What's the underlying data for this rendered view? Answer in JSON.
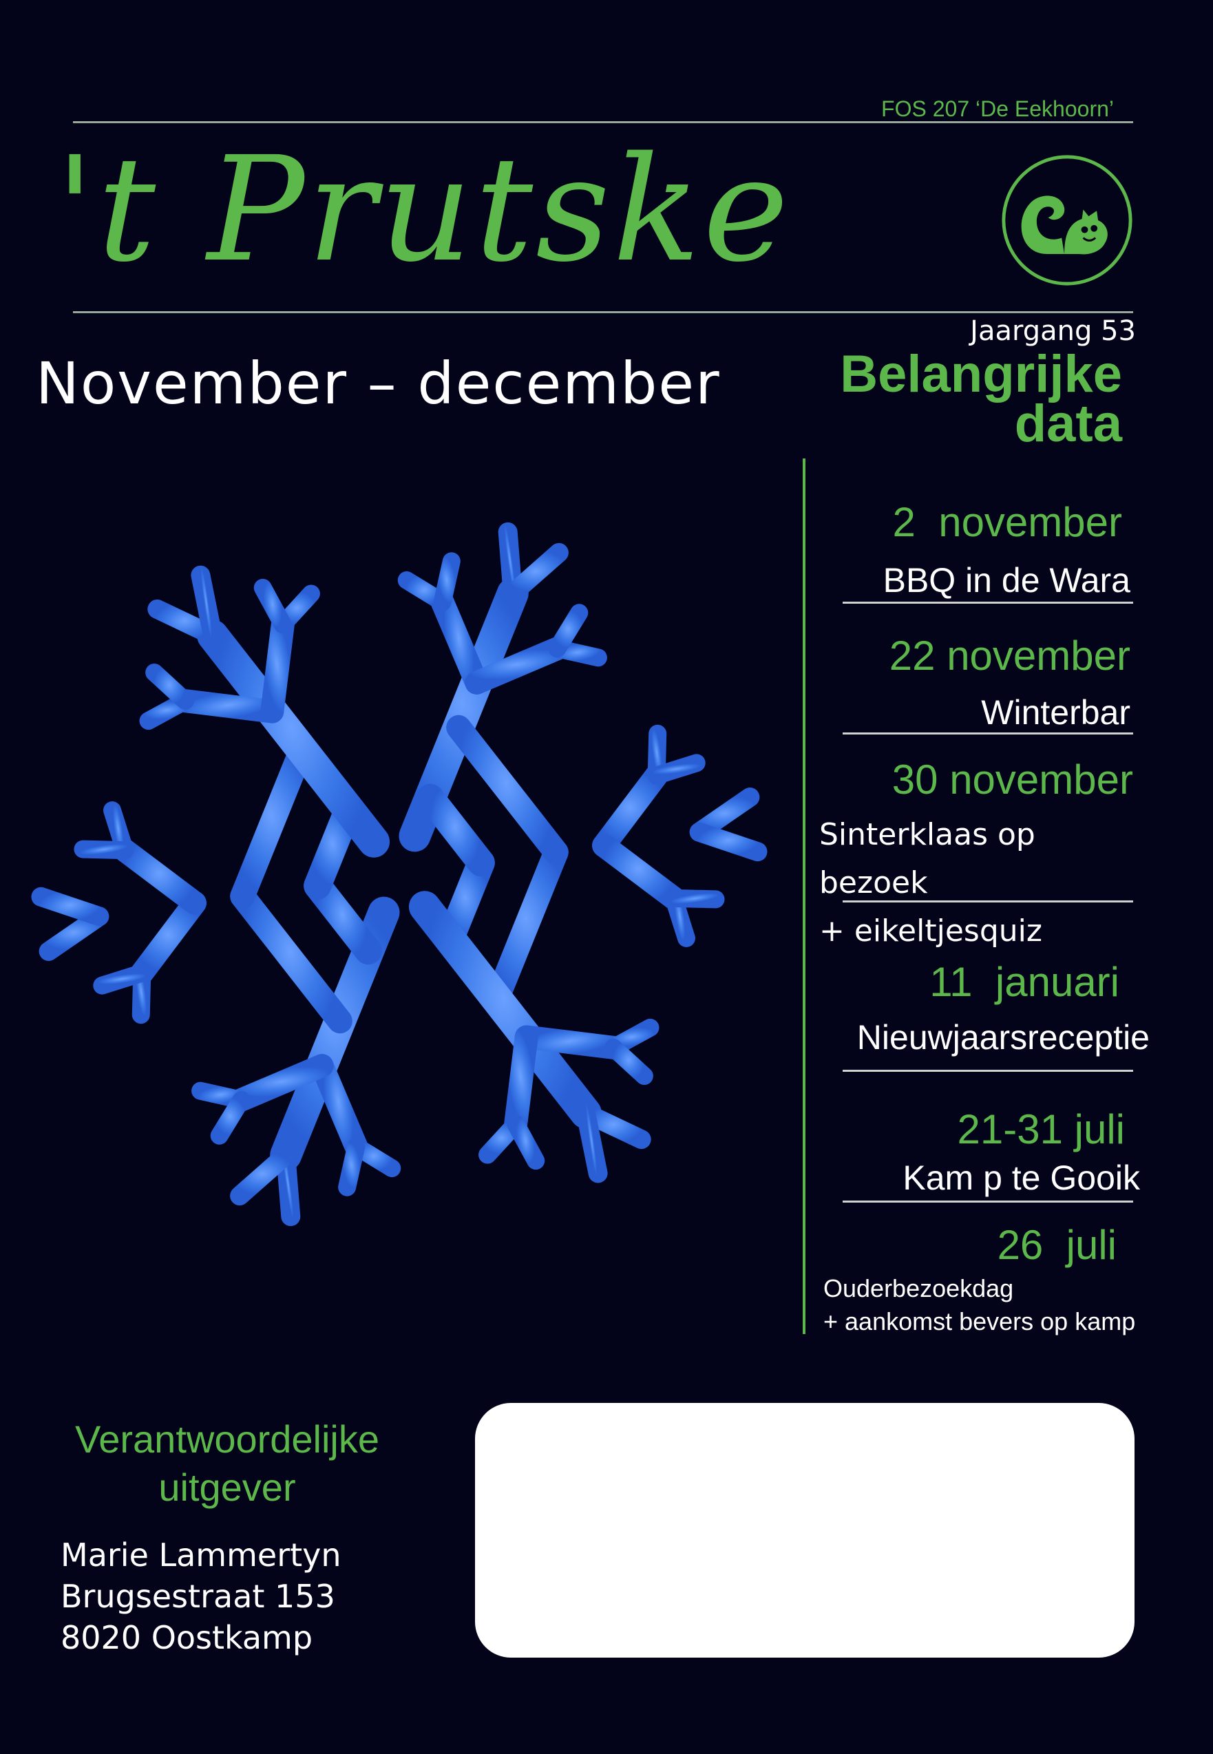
{
  "header": {
    "organization": "FOS 207 ‘De Eekhoorn’",
    "title": "'t Prutske",
    "volume": "Jaargang 53"
  },
  "issue": {
    "period": "November – december"
  },
  "important_dates": {
    "heading_line1": "Belangrijke",
    "heading_line2": "data",
    "events": [
      {
        "date": "2  november",
        "name": "BBQ in de Wara"
      },
      {
        "date": "22 november",
        "name": "Winterbar"
      },
      {
        "date": "30 november",
        "name": "Sinterklaas op bezoek",
        "name_line2": "+ eikeltjesquiz"
      },
      {
        "date": "11  januari",
        "name": "Nieuwjaarsreceptie"
      },
      {
        "date": "21-31 juli",
        "name": "Kam p te Gooik"
      },
      {
        "date": "26  juli",
        "name": "Ouderbezoekdag",
        "name_line2": "+ aankomst bevers op kamp"
      }
    ]
  },
  "publisher": {
    "title_line1": "Verantwoordelijke",
    "title_line2": "uitgever",
    "name": "Marie Lammertyn",
    "street": "Brugsestraat 153",
    "city": "8020 Oostkamp"
  },
  "colors": {
    "background": "#03031a",
    "accent": "#5cb84a",
    "snowflake": "#3a78e8"
  },
  "icons": {
    "logo": "squirrel-icon",
    "illustration": "snowflake-icon"
  }
}
